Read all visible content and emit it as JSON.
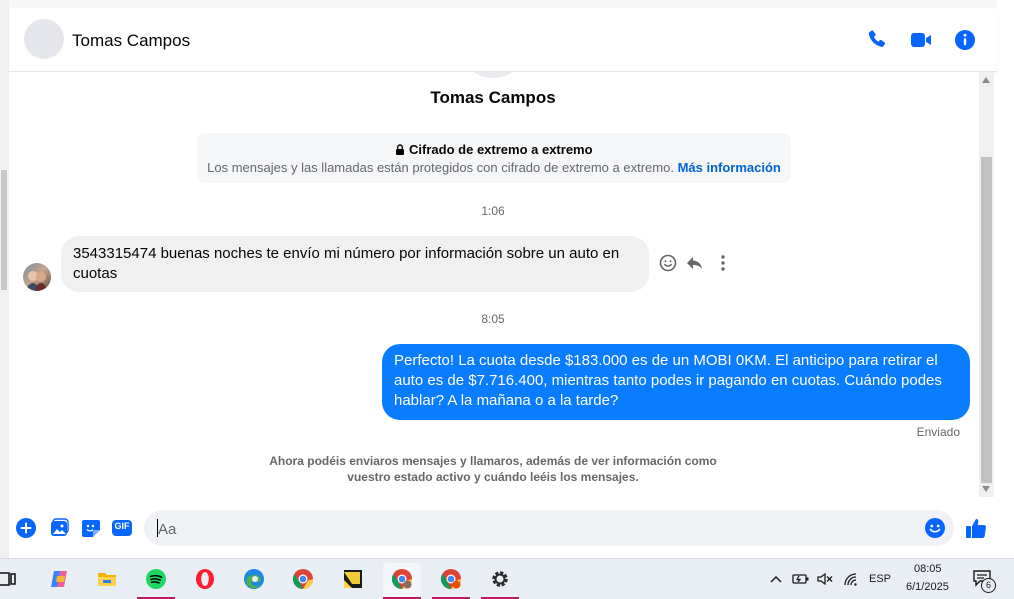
{
  "header": {
    "contact_name": "Tomas Campos",
    "icons": [
      "phone-icon",
      "video-call-icon",
      "info-icon"
    ]
  },
  "conversation": {
    "profile_name": "Tomas Campos",
    "e2e_title": "Cifrado de extremo a extremo",
    "e2e_desc": "Los mensajes y las llamadas están protegidos con cifrado de extremo a extremo.",
    "e2e_link": "Más información",
    "timestamp_1": "1:06",
    "incoming_message": "3543315474 buenas noches te envío mi número por información sobre un auto en cuotas",
    "timestamp_2": "8:05",
    "outgoing_message": "Perfecto! La cuota desde $183.000 es de un MOBI 0KM. El anticipo para retirar el auto es de $7.716.400, mientras tanto podes ir pagando en cuotas. Cuándo podes hablar? A la mañana o a la tarde?",
    "sent_status": "Enviado",
    "notice_line1": "Ahora podéis enviaros mensajes y llamaros, además de ver información como",
    "notice_line2": "vuestro estado activo y cuándo leéis los mensajes."
  },
  "composer": {
    "placeholder": "Aa",
    "left_icons": [
      "plus-icon",
      "image-icon",
      "sticker-icon",
      "gif-icon"
    ],
    "gif_label": "GIF",
    "right_icons": [
      "emoji-icon",
      "thumbs-up-icon"
    ]
  },
  "taskbar": {
    "apps": [
      "task-view",
      "copilot",
      "file-explorer",
      "spotify",
      "opera",
      "edge",
      "chrome",
      "sticky-notes",
      "chrome-profile-1",
      "chrome-profile-2",
      "settings"
    ],
    "language": "ESP",
    "time": "08:05",
    "date": "6/1/2025",
    "notification_count": "6"
  },
  "colors": {
    "accent": "#0a7cff",
    "icon_blue": "#0866ff",
    "link": "#0064d1"
  }
}
